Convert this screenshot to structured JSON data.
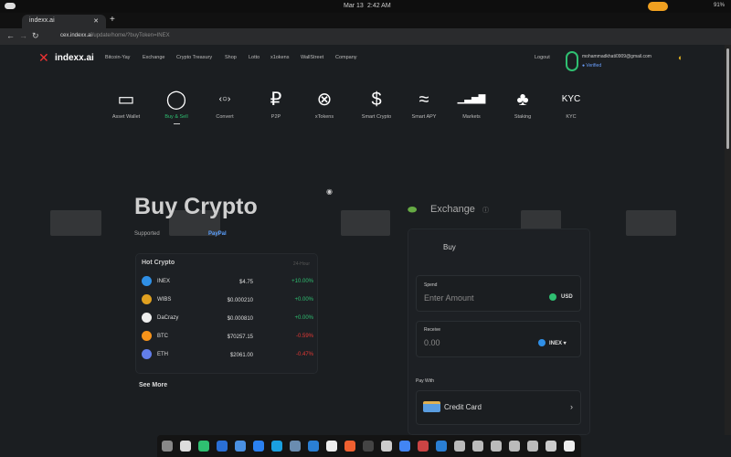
{
  "system": {
    "date": "Mar 13",
    "time": "2:42 AM",
    "battery": "91%"
  },
  "browser": {
    "tab_title": "indexx.ai",
    "new_tab": "+",
    "url_host": "cex.indexx.ai",
    "url_path": "/update/home/?buyToken=INEX"
  },
  "nav": {
    "logo": "indexx.ai",
    "items": [
      "Bitcoin-Yay",
      "Exchange",
      "Crypto Treasury",
      "Shop",
      "Lotto",
      "x1okens",
      "WallStreet",
      "Company"
    ],
    "logout": "Logout",
    "email": "mohammadkhati0909@gmail.com",
    "verified": "Verified"
  },
  "features": [
    {
      "label": "Asset Wallet",
      "icon": "▭"
    },
    {
      "label": "Buy & Sell",
      "icon": "◯"
    },
    {
      "label": "Convert",
      "icon": "‹○›"
    },
    {
      "label": "P2P",
      "icon": "₽"
    },
    {
      "label": "xTokens",
      "icon": "⊗"
    },
    {
      "label": "Smart Crypto",
      "icon": "$"
    },
    {
      "label": "Smart APY",
      "icon": "≈"
    },
    {
      "label": "Markets",
      "icon": "▁▃▅▇"
    },
    {
      "label": "Staking",
      "icon": "♣"
    },
    {
      "label": "KYC",
      "icon": "KYC"
    }
  ],
  "hero": {
    "title": "Buy Crypto",
    "supported": "Supported",
    "paypal": "PayPal"
  },
  "hot": {
    "title": "Hot Crypto",
    "period": "24-Hour",
    "see_more": "See More",
    "rows": [
      {
        "name": "INEX",
        "price": "$4.75",
        "change": "+10.00%",
        "up": true,
        "color": "#2f8fe6"
      },
      {
        "name": "WIBS",
        "price": "$0.000210",
        "change": "+0.00%",
        "up": true,
        "color": "#e0a020"
      },
      {
        "name": "DaCrazy",
        "price": "$0.000810",
        "change": "+0.00%",
        "up": true,
        "color": "#eeeeee"
      },
      {
        "name": "BTC",
        "price": "$70257.15",
        "change": "-0.59%",
        "up": false,
        "color": "#f7931a"
      },
      {
        "name": "ETH",
        "price": "$2061.00",
        "change": "-0.47%",
        "up": false,
        "color": "#627eea"
      }
    ]
  },
  "exchange": {
    "title": "Exchange",
    "tab_buy": "Buy",
    "spend_label": "Spend",
    "spend_placeholder": "Enter Amount",
    "spend_currency": "USD",
    "receive_label": "Receive",
    "receive_value": "0.00",
    "receive_currency": "INEX",
    "pay_with": "Pay With",
    "method": "Credit Card"
  },
  "colors": {
    "accent": "#2fbf71",
    "up": "#2fbf71",
    "down": "#e53935"
  }
}
